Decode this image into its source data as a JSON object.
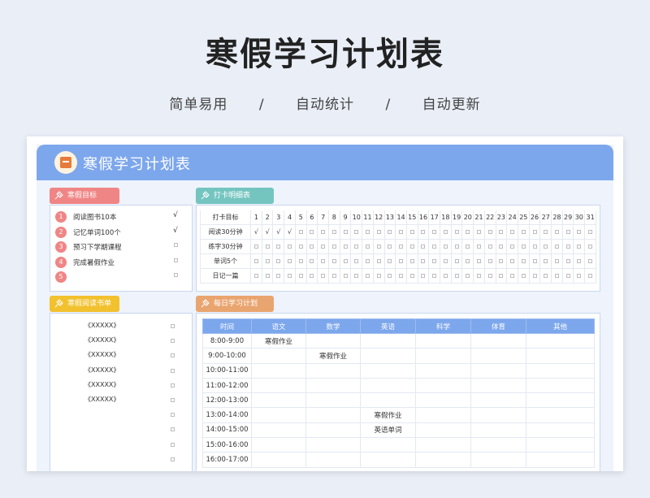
{
  "header": {
    "title": "寒假学习计划表",
    "features": [
      "简单易用",
      "自动统计",
      "自动更新"
    ],
    "separator": "/"
  },
  "banner": {
    "title": "寒假学习计划表"
  },
  "goals": {
    "title": "寒假目标",
    "color": "#f08585",
    "items": [
      {
        "num": "1",
        "text": "阅读图书10本",
        "check": "√"
      },
      {
        "num": "2",
        "text": "记忆单词100个",
        "check": "√"
      },
      {
        "num": "3",
        "text": "预习下学期课程",
        "check": ""
      },
      {
        "num": "4",
        "text": "完成暑假作业",
        "check": ""
      },
      {
        "num": "5",
        "text": "",
        "check": ""
      }
    ]
  },
  "checkin": {
    "title": "打卡明细表",
    "color": "#74c5c0",
    "header_label": "打卡目标",
    "days": [
      "1",
      "2",
      "3",
      "4",
      "5",
      "6",
      "7",
      "8",
      "9",
      "10",
      "11",
      "12",
      "13",
      "14",
      "15",
      "16",
      "17",
      "18",
      "19",
      "20",
      "21",
      "22",
      "23",
      "24",
      "25",
      "26",
      "27",
      "28",
      "29",
      "30",
      "31"
    ],
    "rows": [
      {
        "label": "阅读30分钟",
        "checked_days": 4,
        "check": "√"
      },
      {
        "label": "练字30分钟",
        "checked_days": 0,
        "check": "√"
      },
      {
        "label": "单词5个",
        "checked_days": 0,
        "check": "√"
      },
      {
        "label": "日记一篇",
        "checked_days": 0,
        "check": "√"
      }
    ]
  },
  "reading": {
    "title": "寒假阅读书单",
    "color": "#f2c12e",
    "books": [
      "《XXXXX》",
      "《XXXXX》",
      "《XXXXX》",
      "《XXXXX》",
      "《XXXXX》",
      "《XXXXX》",
      "",
      "",
      "",
      "",
      ""
    ]
  },
  "schedule": {
    "title": "每日学习计划",
    "color": "#e9a56f",
    "columns": [
      "时间",
      "语文",
      "数学",
      "英语",
      "科学",
      "体育",
      "其他"
    ],
    "rows": [
      {
        "time": "8:00-9:00",
        "cells": [
          "寒假作业",
          "",
          "",
          "",
          "",
          ""
        ]
      },
      {
        "time": "9:00-10:00",
        "cells": [
          "",
          "寒假作业",
          "",
          "",
          "",
          ""
        ]
      },
      {
        "time": "10:00-11:00",
        "cells": [
          "",
          "",
          "",
          "",
          "",
          ""
        ]
      },
      {
        "time": "11:00-12:00",
        "cells": [
          "",
          "",
          "",
          "",
          "",
          ""
        ]
      },
      {
        "time": "12:00-13:00",
        "cells": [
          "",
          "",
          "",
          "",
          "",
          ""
        ]
      },
      {
        "time": "13:00-14:00",
        "cells": [
          "",
          "",
          "寒假作业",
          "",
          "",
          ""
        ]
      },
      {
        "time": "14:00-15:00",
        "cells": [
          "",
          "",
          "英语单词",
          "",
          "",
          ""
        ]
      },
      {
        "time": "15:00-16:00",
        "cells": [
          "",
          "",
          "",
          "",
          "",
          ""
        ]
      },
      {
        "time": "16:00-17:00",
        "cells": [
          "",
          "",
          "",
          "",
          "",
          ""
        ]
      }
    ]
  }
}
